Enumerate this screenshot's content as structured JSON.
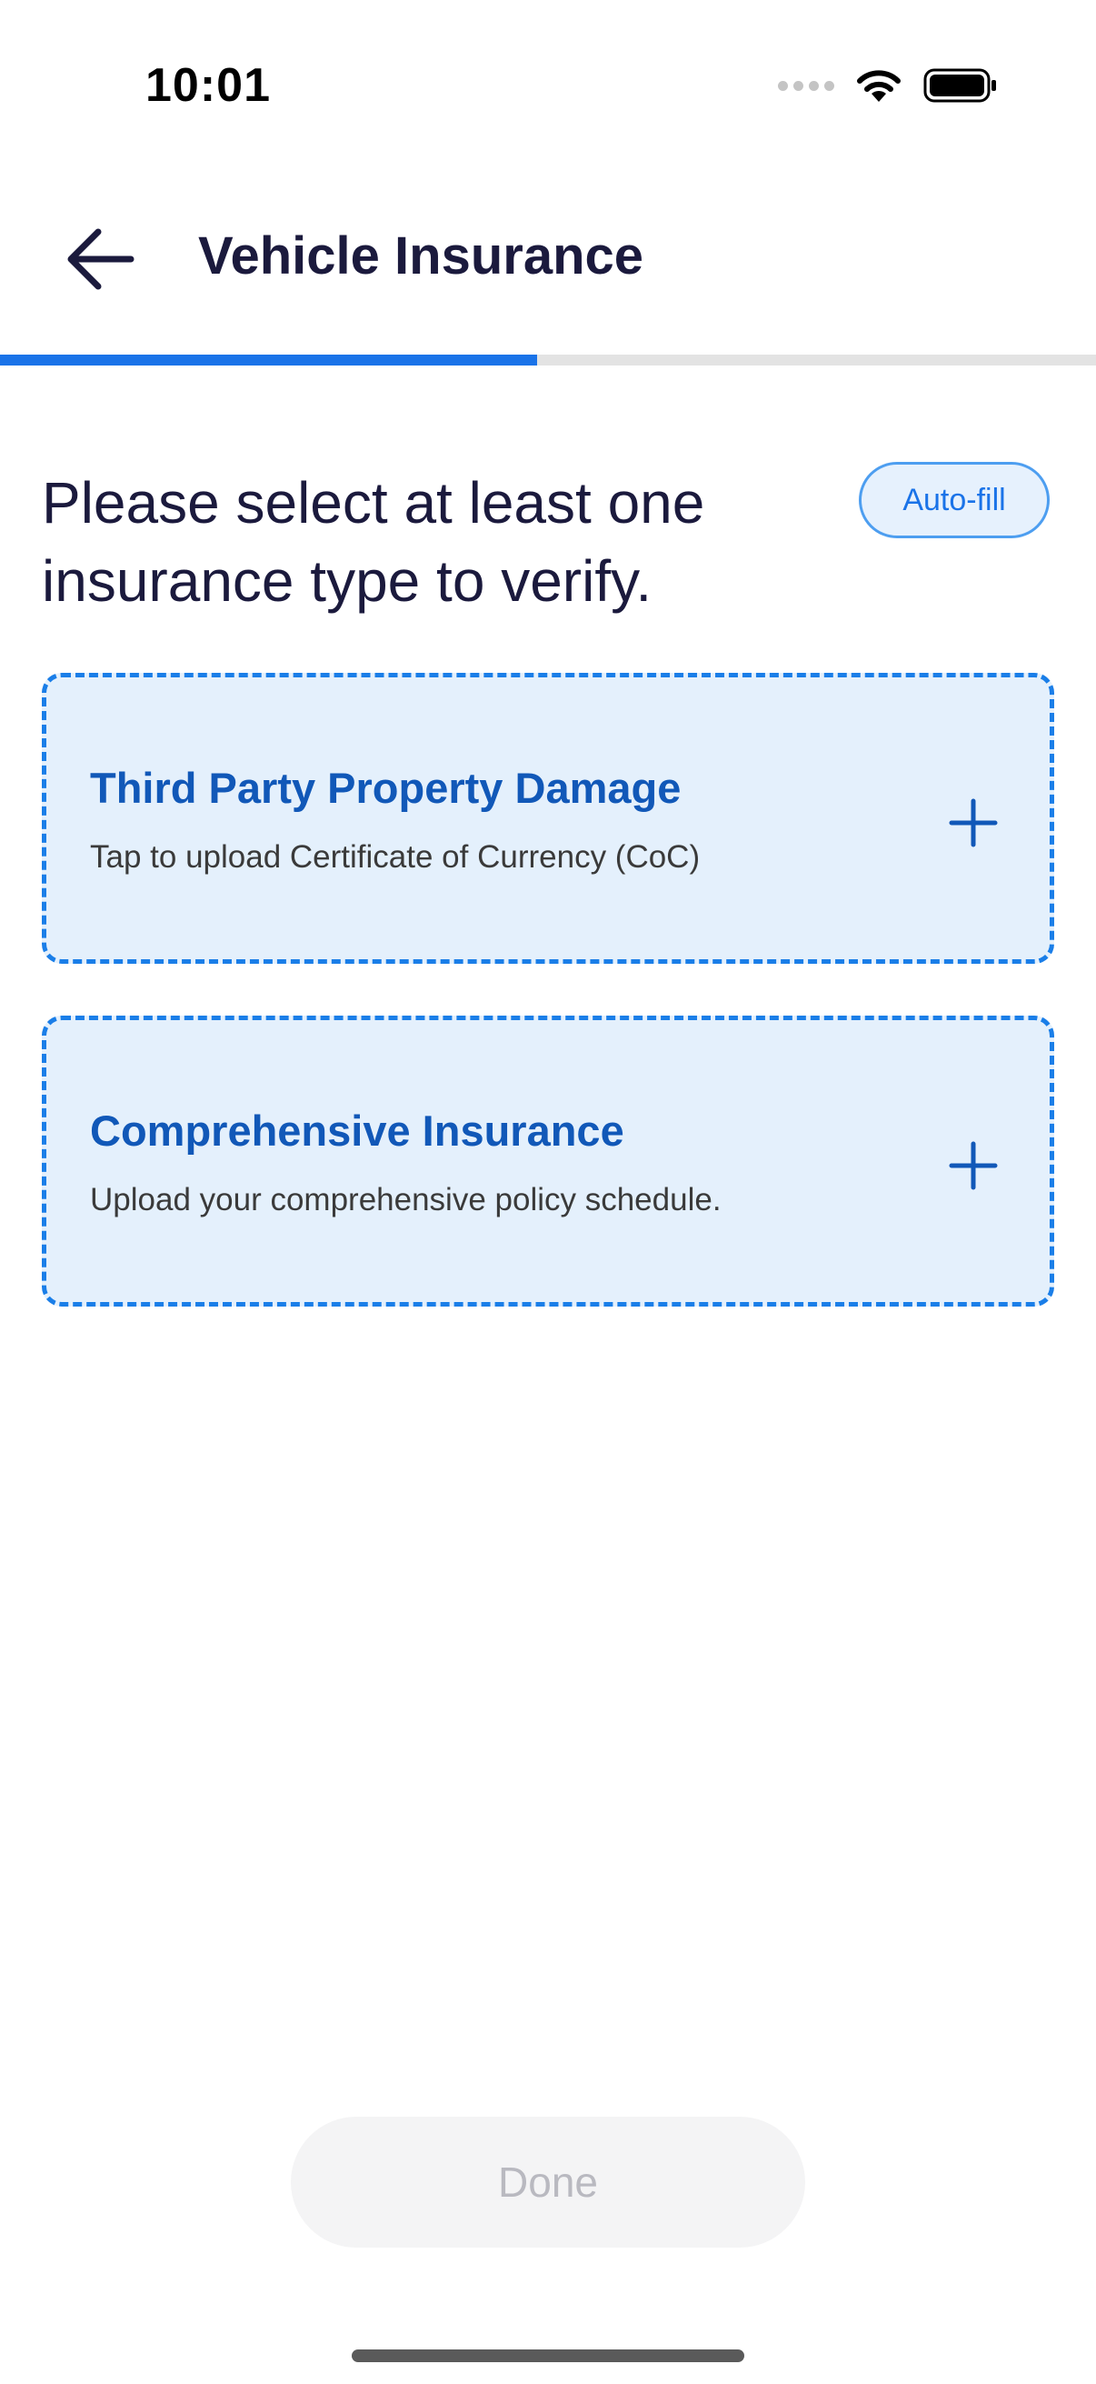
{
  "status_bar": {
    "time": "10:01",
    "icons": [
      "cellular-signal-icon",
      "wifi-icon",
      "battery-icon"
    ]
  },
  "header": {
    "back_icon": "arrow-left-icon",
    "title": "Vehicle Insurance"
  },
  "progress": {
    "fraction": 0.49,
    "fill_color": "#1a73e8",
    "track_color": "#e3e3e3"
  },
  "main": {
    "prompt": "Please select at least one insurance type to verify.",
    "autofill_label": "Auto-fill",
    "cards": [
      {
        "title": "Third Party Property Damage",
        "description": "Tap to upload Certificate of Currency (CoC)",
        "icon": "plus-icon"
      },
      {
        "title": "Comprehensive Insurance",
        "description": "Upload your comprehensive policy schedule.",
        "icon": "plus-icon"
      }
    ]
  },
  "footer": {
    "done_label": "Done",
    "done_enabled": false
  },
  "colors": {
    "accent": "#1a73e8",
    "card_background": "#e4f0fc",
    "card_border": "#1a7ee8",
    "card_title": "#1158b8",
    "text_primary": "#1b1a3d"
  }
}
